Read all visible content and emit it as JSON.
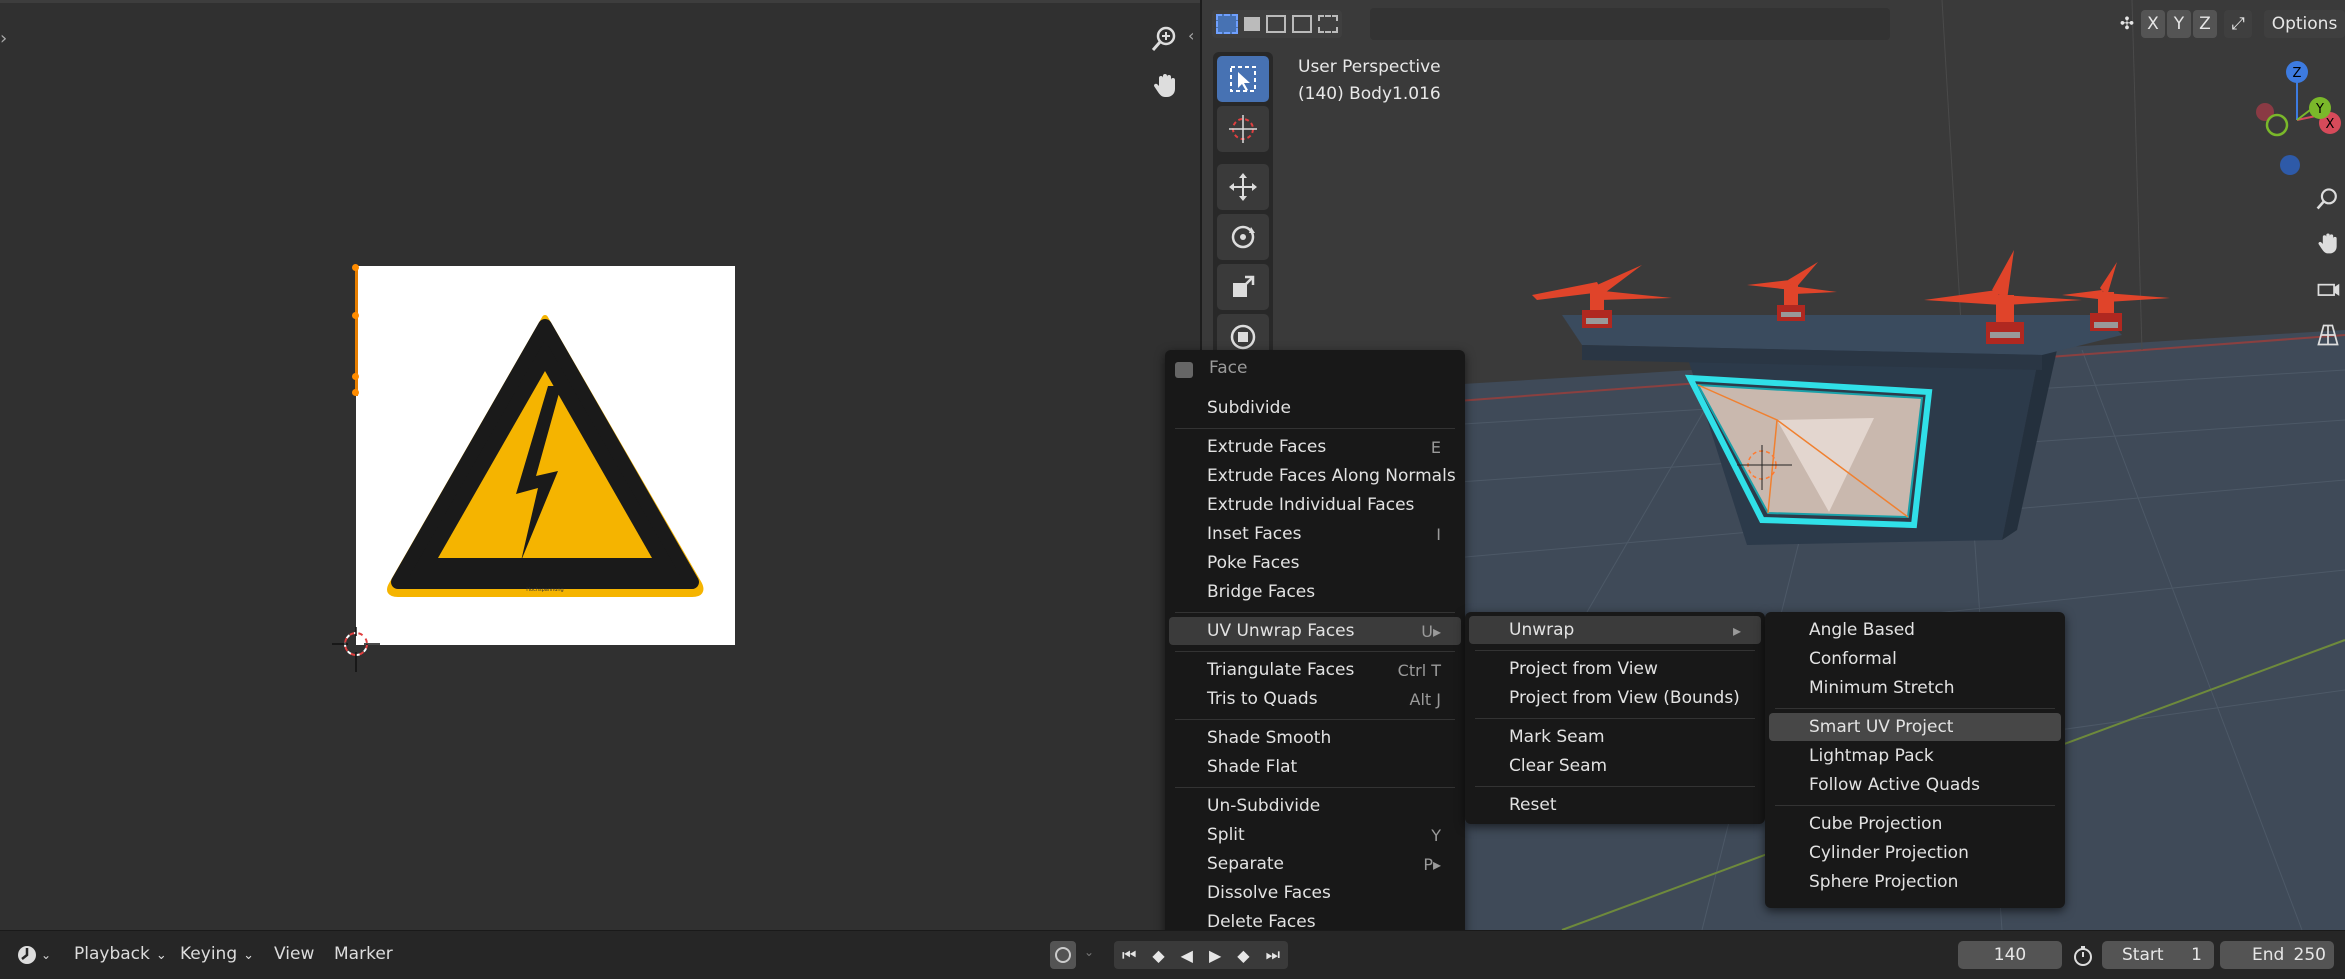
{
  "uv_editor": {
    "image": {
      "alt": "high voltage warning sign",
      "caption": "Hochspannung"
    }
  },
  "viewport": {
    "perspective_label": "User Perspective",
    "object_label": "(140) Body1.016",
    "axes": {
      "x": "X",
      "y": "Y",
      "z": "Z"
    },
    "options_label": "Options",
    "mirror_x": "X",
    "mirror_y": "Y",
    "mirror_z": "Z"
  },
  "face_menu": {
    "title": "Face",
    "items": [
      {
        "label": "Subdivide",
        "shortcut": ""
      },
      {
        "label": "Extrude Faces",
        "shortcut": "E"
      },
      {
        "label": "Extrude Faces Along Normals",
        "shortcut": ""
      },
      {
        "label": "Extrude Individual Faces",
        "shortcut": ""
      },
      {
        "label": "Inset Faces",
        "shortcut": "I"
      },
      {
        "label": "Poke Faces",
        "shortcut": ""
      },
      {
        "label": "Bridge Faces",
        "shortcut": ""
      },
      {
        "label": "UV Unwrap Faces",
        "shortcut": "U▸"
      },
      {
        "label": "Triangulate Faces",
        "shortcut": "Ctrl T"
      },
      {
        "label": "Tris to Quads",
        "shortcut": "Alt J"
      },
      {
        "label": "Shade Smooth",
        "shortcut": ""
      },
      {
        "label": "Shade Flat",
        "shortcut": ""
      },
      {
        "label": "Un-Subdivide",
        "shortcut": ""
      },
      {
        "label": "Split",
        "shortcut": "Y"
      },
      {
        "label": "Separate",
        "shortcut": "P▸"
      },
      {
        "label": "Dissolve Faces",
        "shortcut": ""
      },
      {
        "label": "Delete Faces",
        "shortcut": ""
      }
    ]
  },
  "uv_menu": {
    "items": [
      {
        "label": "Unwrap",
        "shortcut": "▸"
      },
      {
        "label": "Project from View",
        "shortcut": ""
      },
      {
        "label": "Project from View (Bounds)",
        "shortcut": ""
      },
      {
        "label": "Mark Seam",
        "shortcut": ""
      },
      {
        "label": "Clear Seam",
        "shortcut": ""
      },
      {
        "label": "Reset",
        "shortcut": ""
      }
    ]
  },
  "unwrap_menu": {
    "items": [
      {
        "label": "Angle Based"
      },
      {
        "label": "Conformal"
      },
      {
        "label": "Minimum Stretch"
      },
      {
        "label": "Smart UV Project"
      },
      {
        "label": "Lightmap Pack"
      },
      {
        "label": "Follow Active Quads"
      },
      {
        "label": "Cube Projection"
      },
      {
        "label": "Cylinder Projection"
      },
      {
        "label": "Sphere Projection"
      }
    ]
  },
  "timeline": {
    "playback": "Playback",
    "keying": "Keying",
    "view": "View",
    "marker": "Marker",
    "current_frame": "140",
    "start_label": "Start",
    "start_value": "1",
    "end_label": "End",
    "end_value": "250"
  }
}
